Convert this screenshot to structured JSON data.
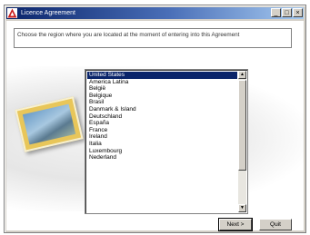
{
  "window": {
    "title": "Licence Agreement",
    "controls": [
      "_",
      "□",
      "×"
    ]
  },
  "instruction": "Choose the region where you are located at the moment of entering into this Agreement",
  "regions": [
    "United States",
    "America Latina",
    "België",
    "Belgique",
    "Brasil",
    "Danmark & Island",
    "Deutschland",
    "España",
    "France",
    "Ireland",
    "Italia",
    "Luxembourg",
    "Nederland"
  ],
  "selected_region": "United States",
  "buttons": {
    "next": "Next >",
    "quit": "Quit"
  },
  "colors": {
    "titlebar_start": "#0a246a",
    "selection": "#0a246a",
    "app_icon": "#cc1f1f"
  },
  "icons": {
    "app": "adobe-logo-icon",
    "minimize": "minimize-icon",
    "maximize": "maximize-icon",
    "close": "close-icon"
  }
}
